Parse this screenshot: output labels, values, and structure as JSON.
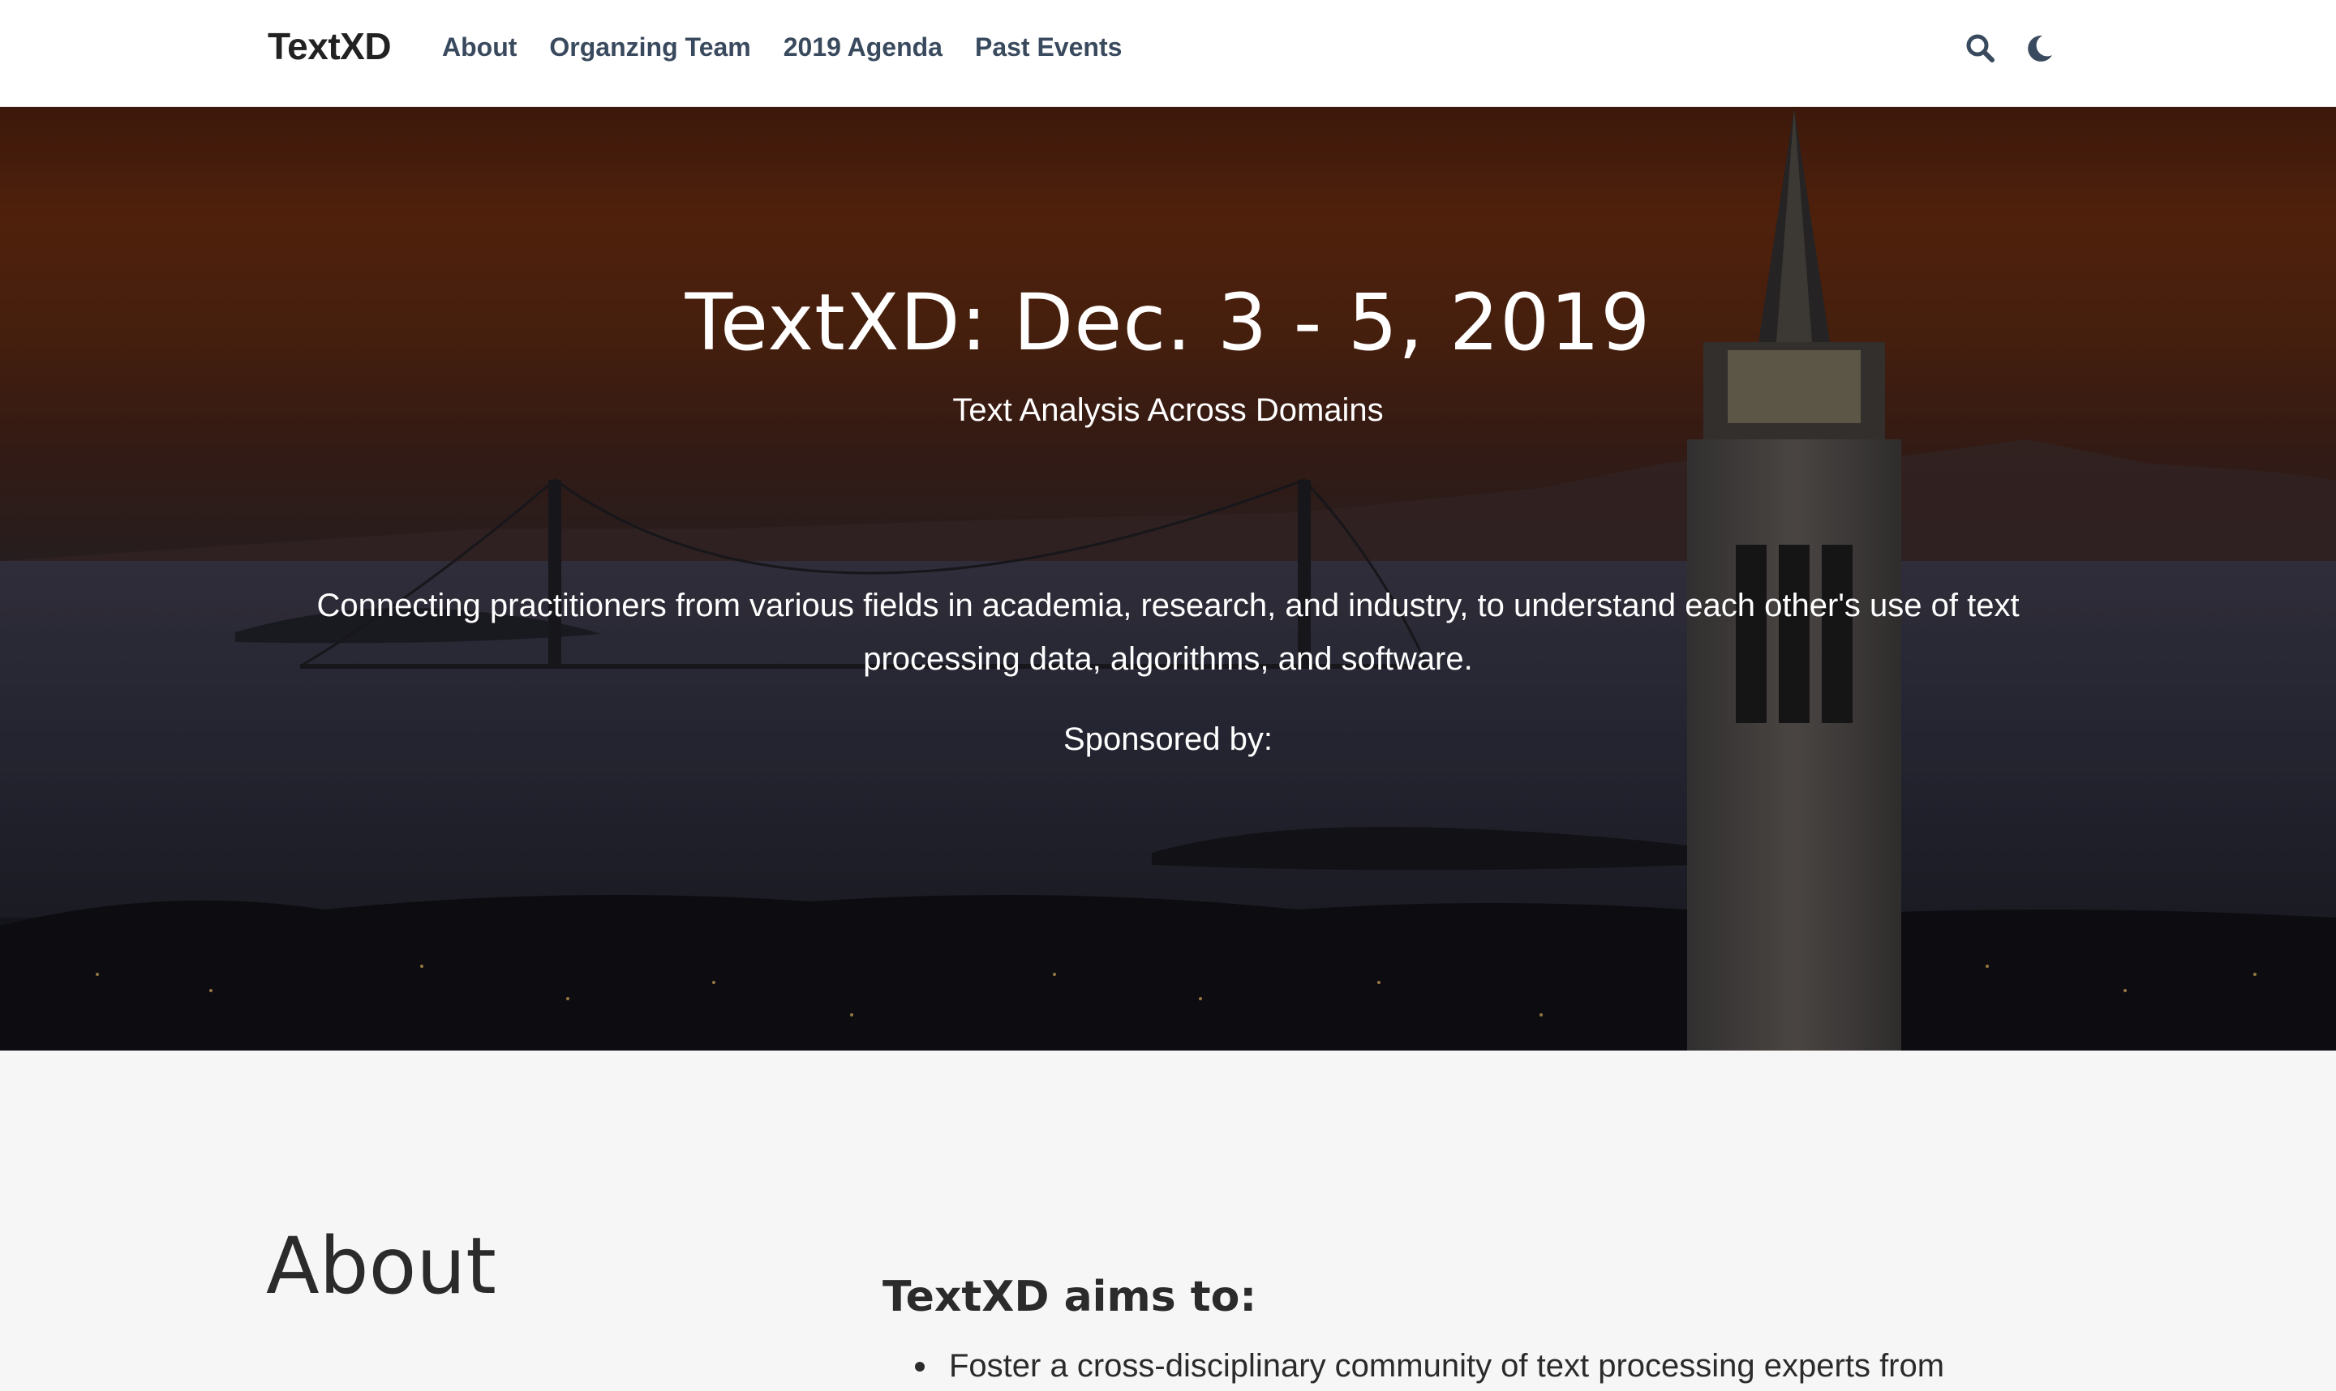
{
  "navbar": {
    "brand": "TextXD",
    "links": [
      {
        "label": "About"
      },
      {
        "label": "Organzing Team"
      },
      {
        "label": "2019 Agenda"
      },
      {
        "label": "Past Events"
      }
    ],
    "icons": [
      "search-icon",
      "moon-icon"
    ],
    "link_color": "#3a4a5e"
  },
  "hero": {
    "title": "TextXD: Dec. 3 - 5, 2019",
    "subtitle": "Text Analysis Across Domains",
    "description": "Connecting practitioners from various fields in academia, research, and industry, to understand each other's use of text processing data, algorithms, and software.",
    "sponsored_label": "Sponsored by:"
  },
  "about": {
    "heading": "About",
    "aims_heading": "TextXD aims to:",
    "aims": [
      "Foster a cross-disciplinary community of text processing experts from"
    ]
  }
}
